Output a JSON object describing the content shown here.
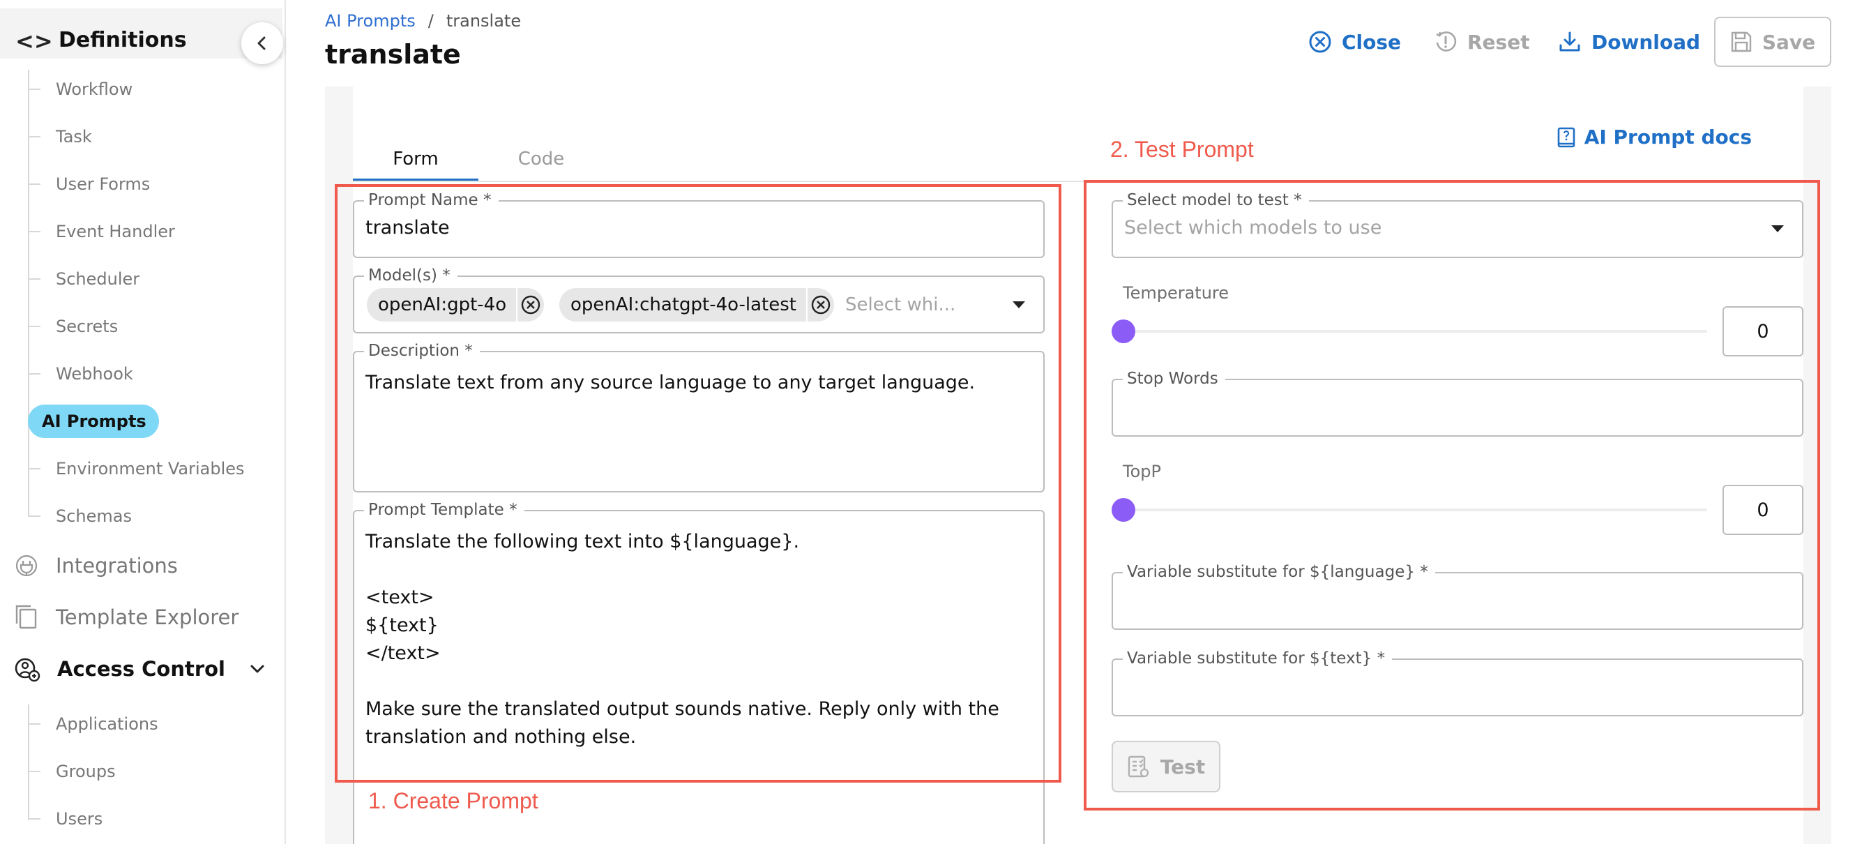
{
  "sidebar": {
    "definitions": {
      "code_glyph": "<>",
      "title": "Definitions"
    },
    "items": [
      {
        "label": "Workflow"
      },
      {
        "label": "Task"
      },
      {
        "label": "User Forms"
      },
      {
        "label": "Event Handler"
      },
      {
        "label": "Scheduler"
      },
      {
        "label": "Secrets"
      },
      {
        "label": "Webhook"
      },
      {
        "label": "AI Prompts",
        "active": true
      },
      {
        "label": "Environment Variables"
      },
      {
        "label": "Schemas"
      }
    ],
    "sections": {
      "integrations": "Integrations",
      "template_explorer": "Template Explorer",
      "access_control": "Access Control"
    },
    "access_items": [
      {
        "label": "Applications"
      },
      {
        "label": "Groups"
      },
      {
        "label": "Users"
      }
    ]
  },
  "header": {
    "breadcrumb": {
      "parent": "AI Prompts",
      "separator": "/",
      "current": "translate"
    },
    "title": "translate",
    "actions": {
      "close": "Close",
      "reset": "Reset",
      "download": "Download",
      "save": "Save"
    }
  },
  "tabs": {
    "form": "Form",
    "code": "Code"
  },
  "docs_link": "AI Prompt docs",
  "form": {
    "prompt_name": {
      "label": "Prompt Name *",
      "value": "translate"
    },
    "models": {
      "label": "Model(s) *",
      "chips": [
        "openAI:gpt-4o",
        "openAI:chatgpt-4o-latest"
      ],
      "placeholder": "Select whi..."
    },
    "description": {
      "label": "Description *",
      "value": "Translate text from any source language to any target language."
    },
    "prompt_template": {
      "label": "Prompt Template *",
      "value": "Translate the following text into ${language}.\n\n<text>\n${text}\n</text>\n\nMake sure the translated output sounds native. Reply only with the\ntranslation and nothing else."
    }
  },
  "test": {
    "model": {
      "label": "Select model to test *",
      "placeholder": "Select which models to use"
    },
    "temperature": {
      "label": "Temperature",
      "value": "0"
    },
    "stop_words": {
      "label": "Stop Words"
    },
    "topp": {
      "label": "TopP",
      "value": "0"
    },
    "var_language": {
      "label": "Variable substitute for ${language} *"
    },
    "var_text": {
      "label": "Variable substitute for ${text} *"
    },
    "button": "Test"
  },
  "annotations": {
    "create": "1. Create Prompt",
    "test": "2. Test Prompt"
  },
  "colors": {
    "accent": "#1f6fc7",
    "active_nav": "#7fd8f6",
    "annotation": "#ef5a4d",
    "slider": "#8b5cf6"
  }
}
